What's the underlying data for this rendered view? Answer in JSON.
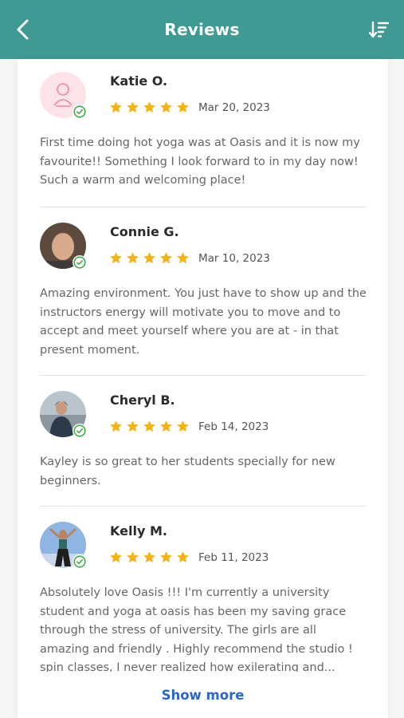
{
  "header": {
    "title": "Reviews",
    "back_icon": "chevron-left-icon",
    "sort_icon": "sort-descending-icon",
    "background": "#3f9a94"
  },
  "reviews": [
    {
      "name": "Katie O.",
      "rating": 5,
      "date": "Mar 20, 2023",
      "text": "First time doing hot yoga was at Oasis and it is now my favourite!! Something I look forward to in my day now! Such a warm and welcoming place!",
      "verified": true,
      "avatar": "placeholder-person-icon"
    },
    {
      "name": "Connie G.",
      "rating": 5,
      "date": "Mar 10, 2023",
      "text": "Amazing environment. You just have to show up and the instructors energy will motivate you to move and to accept and meet yourself where you are at - in that present moment.",
      "verified": true,
      "avatar": "photo"
    },
    {
      "name": "Cheryl B.",
      "rating": 5,
      "date": "Feb 14, 2023",
      "text": "Kayley is so great to her students specially for new beginners.",
      "verified": true,
      "avatar": "photo"
    },
    {
      "name": "Kelly M.",
      "rating": 5,
      "date": "Feb 11, 2023",
      "text": "Absolutely love Oasis !!! I'm currently a university student and yoga at oasis has been my saving grace through the stress of university. The girls are all amazing and friendly . Highly recommend the studio ! spin classes, I never realized how exilerating and...",
      "verified": true,
      "avatar": "photo"
    }
  ],
  "show_more_label": "Show more",
  "colors": {
    "star": "#f5b316",
    "verified": "#3fae4a",
    "link": "#2c66c9"
  }
}
